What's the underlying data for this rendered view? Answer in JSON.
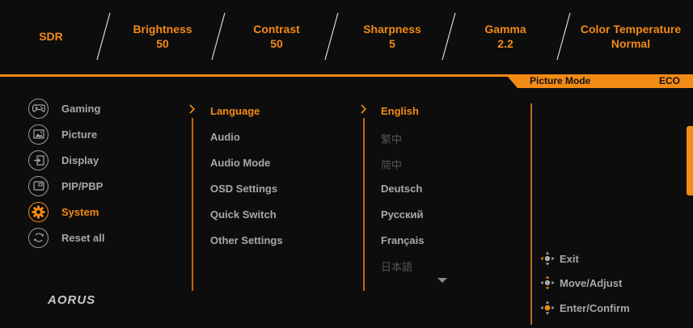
{
  "colors": {
    "accent": "#f28a16",
    "text": "#a8a8a8",
    "dim": "#555555",
    "background": "#0d0d0d"
  },
  "status": {
    "mode": "SDR",
    "brightness_label": "Brightness",
    "brightness_value": "50",
    "contrast_label": "Contrast",
    "contrast_value": "50",
    "sharpness_label": "Sharpness",
    "sharpness_value": "5",
    "gamma_label": "Gamma",
    "gamma_value": "2.2",
    "color_temp_label": "Color Temperature",
    "color_temp_value": "Normal"
  },
  "picture_mode": {
    "label": "Picture Mode",
    "value": "ECO"
  },
  "main_menu": [
    {
      "label": "Gaming",
      "icon": "gamepad-icon"
    },
    {
      "label": "Picture",
      "icon": "picture-icon"
    },
    {
      "label": "Display",
      "icon": "display-input-icon"
    },
    {
      "label": "PIP/PBP",
      "icon": "pip-icon"
    },
    {
      "label": "System",
      "icon": "gear-icon",
      "active": true
    },
    {
      "label": "Reset all",
      "icon": "reset-icon"
    }
  ],
  "system_menu": [
    "Language",
    "Audio",
    "Audio Mode",
    "OSD Settings",
    "Quick Switch",
    "Other Settings"
  ],
  "languages": [
    "English",
    "繁中",
    "简中",
    "Deutsch",
    "Русский",
    "Français",
    "日本語"
  ],
  "logo_text": "AORUS",
  "hints": [
    {
      "label": "Exit",
      "icon": "joystick-left-icon"
    },
    {
      "label": "Move/Adjust",
      "icon": "joystick-updown-icon"
    },
    {
      "label": "Enter/Confirm",
      "icon": "joystick-press-icon"
    }
  ]
}
